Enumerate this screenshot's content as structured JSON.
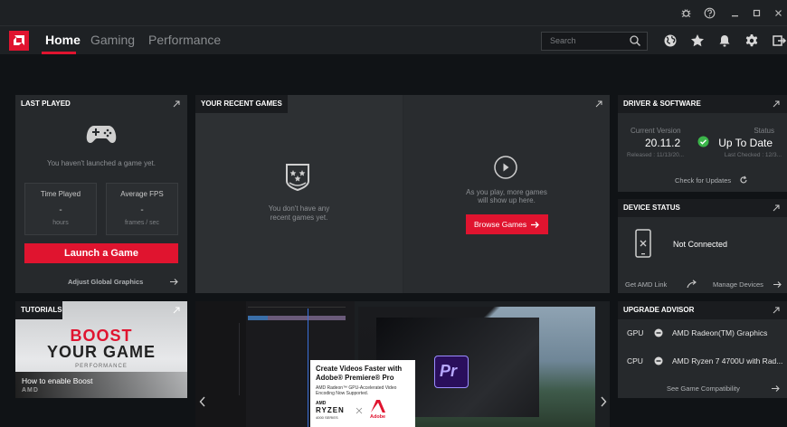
{
  "nav": {
    "tabs": [
      {
        "label": "Home"
      },
      {
        "label": "Gaming"
      },
      {
        "label": "Performance"
      }
    ],
    "search_placeholder": "Search"
  },
  "last_played": {
    "title": "LAST PLAYED",
    "empty_text": "You haven't launched a game yet.",
    "time_played": {
      "title": "Time Played",
      "value": "-",
      "unit": "hours"
    },
    "avg_fps": {
      "title": "Average FPS",
      "value": "-",
      "unit": "frames / sec"
    },
    "launch_label": "Launch a Game",
    "adjust_label": "Adjust Global Graphics"
  },
  "recent_games": {
    "title": "YOUR RECENT GAMES",
    "empty_line1": "You don't have any",
    "empty_line2": "recent games yet.",
    "play_line1": "As you play, more games",
    "play_line2": "will show up here.",
    "browse_label": "Browse Games"
  },
  "driver": {
    "title": "DRIVER & SOFTWARE",
    "current_label": "Current Version",
    "version": "20.11.2",
    "released": "Released : 11/13/20...",
    "status_label": "Status",
    "status": "Up To Date",
    "last_checked": "Last Checked : 12/3...",
    "check_label": "Check for Updates"
  },
  "device": {
    "title": "DEVICE STATUS",
    "status": "Not Connected",
    "get_link": "Get AMD Link",
    "manage": "Manage Devices"
  },
  "tutorials": {
    "title": "TUTORIALS",
    "boost_line1": "BOOST",
    "boost_line2": "YOUR GAME",
    "boost_line3": "PERFORMANCE",
    "caption": "How to enable Boost",
    "brand": "AMD"
  },
  "promo": {
    "headline1": "Create Videos Faster with",
    "headline2": "Adobe® Premiere® Pro",
    "sub1": "AMD Radeon™ GPU-Accelerated Video",
    "sub2": "Encoding Now Supported.",
    "ryzen": "RYZEN",
    "series": "4000 SERIES",
    "amd": "AMD",
    "adobe": "Adobe",
    "pr": "Pr"
  },
  "upgrade": {
    "title": "UPGRADE ADVISOR",
    "rows": [
      {
        "label": "GPU",
        "value": "AMD Radeon(TM) Graphics"
      },
      {
        "label": "CPU",
        "value": "AMD Ryzen 7 4700U with Rad..."
      }
    ],
    "compat_label": "See Game Compatibility"
  },
  "colors": {
    "accent": "#e0142f",
    "ok": "#3bb54a"
  }
}
